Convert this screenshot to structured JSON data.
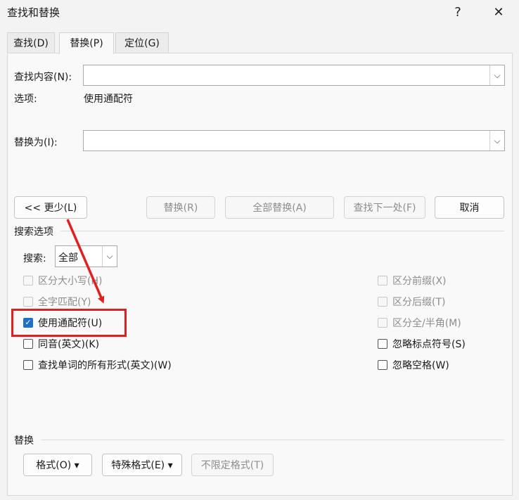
{
  "titlebar": {
    "title": "查找和替换",
    "help_glyph": "?",
    "close_glyph": "✕"
  },
  "tabs": [
    "查找(D)",
    "替换(P)",
    "定位(G)"
  ],
  "active_tab": "替换(P)",
  "find": {
    "label": "查找内容(N):",
    "value": "",
    "options_label": "选项:",
    "options_value": "使用通配符"
  },
  "replace": {
    "label": "替换为(I):",
    "value": ""
  },
  "buttons": {
    "less": "<< 更少(L)",
    "replace": "替换(R)",
    "replace_all": "全部替换(A)",
    "find_next": "查找下一处(F)",
    "cancel": "取消"
  },
  "search_options": {
    "header": "搜索选项",
    "search_label": "搜索:",
    "search_value": "全部",
    "left": [
      {
        "label": "区分大小写(H)",
        "checked": false,
        "disabled": true
      },
      {
        "label": "全字匹配(Y)",
        "checked": false,
        "disabled": true
      },
      {
        "label": "使用通配符(U)",
        "checked": true,
        "disabled": false
      },
      {
        "label": "同音(英文)(K)",
        "checked": false,
        "disabled": false
      },
      {
        "label": "查找单词的所有形式(英文)(W)",
        "checked": false,
        "disabled": false
      }
    ],
    "right": [
      {
        "label": "区分前缀(X)",
        "checked": false,
        "disabled": true
      },
      {
        "label": "区分后缀(T)",
        "checked": false,
        "disabled": true
      },
      {
        "label": "区分全/半角(M)",
        "checked": false,
        "disabled": true
      },
      {
        "label": "忽略标点符号(S)",
        "checked": false,
        "disabled": false
      },
      {
        "label": "忽略空格(W)",
        "checked": false,
        "disabled": false
      }
    ]
  },
  "replace_section": {
    "header": "替换",
    "format_button": "格式(O) ▾",
    "special_button": "特殊格式(E) ▾",
    "no_format_button": "不限定格式(T)"
  },
  "colors": {
    "annotation": "#e02020",
    "accent": "#1f6fc4"
  }
}
